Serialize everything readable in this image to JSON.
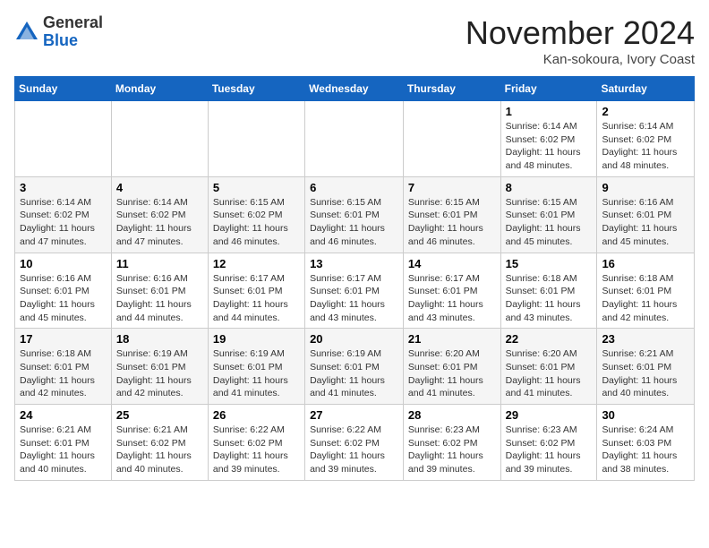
{
  "header": {
    "logo_line1": "General",
    "logo_line2": "Blue",
    "month_title": "November 2024",
    "location": "Kan-sokoura, Ivory Coast"
  },
  "weekdays": [
    "Sunday",
    "Monday",
    "Tuesday",
    "Wednesday",
    "Thursday",
    "Friday",
    "Saturday"
  ],
  "weeks": [
    [
      {
        "day": "",
        "info": ""
      },
      {
        "day": "",
        "info": ""
      },
      {
        "day": "",
        "info": ""
      },
      {
        "day": "",
        "info": ""
      },
      {
        "day": "",
        "info": ""
      },
      {
        "day": "1",
        "info": "Sunrise: 6:14 AM\nSunset: 6:02 PM\nDaylight: 11 hours and 48 minutes."
      },
      {
        "day": "2",
        "info": "Sunrise: 6:14 AM\nSunset: 6:02 PM\nDaylight: 11 hours and 48 minutes."
      }
    ],
    [
      {
        "day": "3",
        "info": "Sunrise: 6:14 AM\nSunset: 6:02 PM\nDaylight: 11 hours and 47 minutes."
      },
      {
        "day": "4",
        "info": "Sunrise: 6:14 AM\nSunset: 6:02 PM\nDaylight: 11 hours and 47 minutes."
      },
      {
        "day": "5",
        "info": "Sunrise: 6:15 AM\nSunset: 6:02 PM\nDaylight: 11 hours and 46 minutes."
      },
      {
        "day": "6",
        "info": "Sunrise: 6:15 AM\nSunset: 6:01 PM\nDaylight: 11 hours and 46 minutes."
      },
      {
        "day": "7",
        "info": "Sunrise: 6:15 AM\nSunset: 6:01 PM\nDaylight: 11 hours and 46 minutes."
      },
      {
        "day": "8",
        "info": "Sunrise: 6:15 AM\nSunset: 6:01 PM\nDaylight: 11 hours and 45 minutes."
      },
      {
        "day": "9",
        "info": "Sunrise: 6:16 AM\nSunset: 6:01 PM\nDaylight: 11 hours and 45 minutes."
      }
    ],
    [
      {
        "day": "10",
        "info": "Sunrise: 6:16 AM\nSunset: 6:01 PM\nDaylight: 11 hours and 45 minutes."
      },
      {
        "day": "11",
        "info": "Sunrise: 6:16 AM\nSunset: 6:01 PM\nDaylight: 11 hours and 44 minutes."
      },
      {
        "day": "12",
        "info": "Sunrise: 6:17 AM\nSunset: 6:01 PM\nDaylight: 11 hours and 44 minutes."
      },
      {
        "day": "13",
        "info": "Sunrise: 6:17 AM\nSunset: 6:01 PM\nDaylight: 11 hours and 43 minutes."
      },
      {
        "day": "14",
        "info": "Sunrise: 6:17 AM\nSunset: 6:01 PM\nDaylight: 11 hours and 43 minutes."
      },
      {
        "day": "15",
        "info": "Sunrise: 6:18 AM\nSunset: 6:01 PM\nDaylight: 11 hours and 43 minutes."
      },
      {
        "day": "16",
        "info": "Sunrise: 6:18 AM\nSunset: 6:01 PM\nDaylight: 11 hours and 42 minutes."
      }
    ],
    [
      {
        "day": "17",
        "info": "Sunrise: 6:18 AM\nSunset: 6:01 PM\nDaylight: 11 hours and 42 minutes."
      },
      {
        "day": "18",
        "info": "Sunrise: 6:19 AM\nSunset: 6:01 PM\nDaylight: 11 hours and 42 minutes."
      },
      {
        "day": "19",
        "info": "Sunrise: 6:19 AM\nSunset: 6:01 PM\nDaylight: 11 hours and 41 minutes."
      },
      {
        "day": "20",
        "info": "Sunrise: 6:19 AM\nSunset: 6:01 PM\nDaylight: 11 hours and 41 minutes."
      },
      {
        "day": "21",
        "info": "Sunrise: 6:20 AM\nSunset: 6:01 PM\nDaylight: 11 hours and 41 minutes."
      },
      {
        "day": "22",
        "info": "Sunrise: 6:20 AM\nSunset: 6:01 PM\nDaylight: 11 hours and 41 minutes."
      },
      {
        "day": "23",
        "info": "Sunrise: 6:21 AM\nSunset: 6:01 PM\nDaylight: 11 hours and 40 minutes."
      }
    ],
    [
      {
        "day": "24",
        "info": "Sunrise: 6:21 AM\nSunset: 6:01 PM\nDaylight: 11 hours and 40 minutes."
      },
      {
        "day": "25",
        "info": "Sunrise: 6:21 AM\nSunset: 6:02 PM\nDaylight: 11 hours and 40 minutes."
      },
      {
        "day": "26",
        "info": "Sunrise: 6:22 AM\nSunset: 6:02 PM\nDaylight: 11 hours and 39 minutes."
      },
      {
        "day": "27",
        "info": "Sunrise: 6:22 AM\nSunset: 6:02 PM\nDaylight: 11 hours and 39 minutes."
      },
      {
        "day": "28",
        "info": "Sunrise: 6:23 AM\nSunset: 6:02 PM\nDaylight: 11 hours and 39 minutes."
      },
      {
        "day": "29",
        "info": "Sunrise: 6:23 AM\nSunset: 6:02 PM\nDaylight: 11 hours and 39 minutes."
      },
      {
        "day": "30",
        "info": "Sunrise: 6:24 AM\nSunset: 6:03 PM\nDaylight: 11 hours and 38 minutes."
      }
    ]
  ]
}
